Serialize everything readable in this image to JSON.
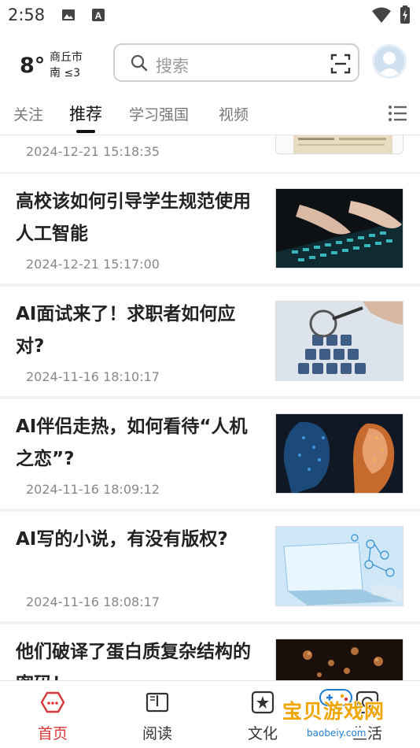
{
  "statusbar": {
    "time": "2:58"
  },
  "weather": {
    "temperature": "8°",
    "city": "商丘市",
    "wind": "南 ≤3"
  },
  "search": {
    "placeholder": "搜索"
  },
  "tabs": [
    {
      "label": "关注"
    },
    {
      "label": "推荐"
    },
    {
      "label": "学习强国"
    },
    {
      "label": "视频"
    }
  ],
  "feed": [
    {
      "title": "",
      "date": "2024-12-21 15:18:35"
    },
    {
      "title": "高校该如何引导学生规范使用人工智能",
      "date": "2024-12-21 15:17:00"
    },
    {
      "title": "AI面试来了！求职者如何应对?",
      "date": "2024-11-16 18:10:17"
    },
    {
      "title": "AI伴侣走热，如何看待“人机之恋”?",
      "date": "2024-11-16 18:09:12"
    },
    {
      "title": "AI写的小说，有没有版权?",
      "date": "2024-11-16 18:08:17"
    },
    {
      "title": "他们破译了蛋白质复杂结构的密码！",
      "date": ""
    }
  ],
  "bottom_nav": [
    {
      "label": "首页"
    },
    {
      "label": "阅读"
    },
    {
      "label": "文化"
    },
    {
      "label": "生活"
    }
  ],
  "watermark": {
    "text": "宝贝游戏网",
    "url": "baobeiy.com"
  },
  "colors": {
    "accent": "#d8383a"
  }
}
